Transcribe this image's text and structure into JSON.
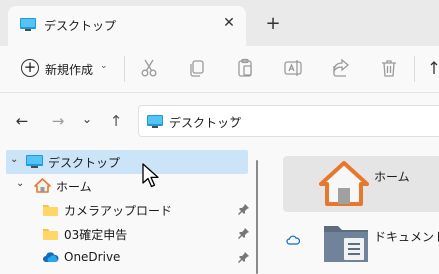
{
  "window": {
    "tab_title": "デスクトップ",
    "close_tab": "✕",
    "new_tab": "+"
  },
  "toolbar": {
    "new_label": "新規作成",
    "new_chevron": "⌄",
    "icons": [
      "cut-icon",
      "copy-icon",
      "paste-icon",
      "rename-icon",
      "share-icon",
      "delete-icon",
      "sort-icon"
    ]
  },
  "nav": {
    "back": "←",
    "forward": "→",
    "recent": "⌄",
    "up": "↑"
  },
  "address": {
    "path": "デスクトップ",
    "chevron": "›"
  },
  "sidebar": {
    "items": [
      {
        "label": "デスクトップ",
        "chevron": "⌄",
        "icon": "desktop-icon",
        "selected": true
      },
      {
        "label": "ホーム",
        "chevron": "⌄",
        "icon": "home-icon"
      },
      {
        "label": "カメラアップロード",
        "icon": "folder-icon",
        "pinned": true
      },
      {
        "label": "03確定申告",
        "icon": "folder-icon",
        "pinned": true
      },
      {
        "label": "OneDrive",
        "icon": "onedrive-icon",
        "pinned": true
      }
    ]
  },
  "content": {
    "items": [
      {
        "label": "ホーム",
        "icon": "home-large-icon"
      },
      {
        "label": "ドキュメント",
        "icon": "documents-folder-icon"
      }
    ]
  },
  "colors": {
    "accent": "#0067c0",
    "selection": "#cce4f7",
    "home_orange": "#e8772e",
    "folder_yellow": "#f5c242"
  }
}
